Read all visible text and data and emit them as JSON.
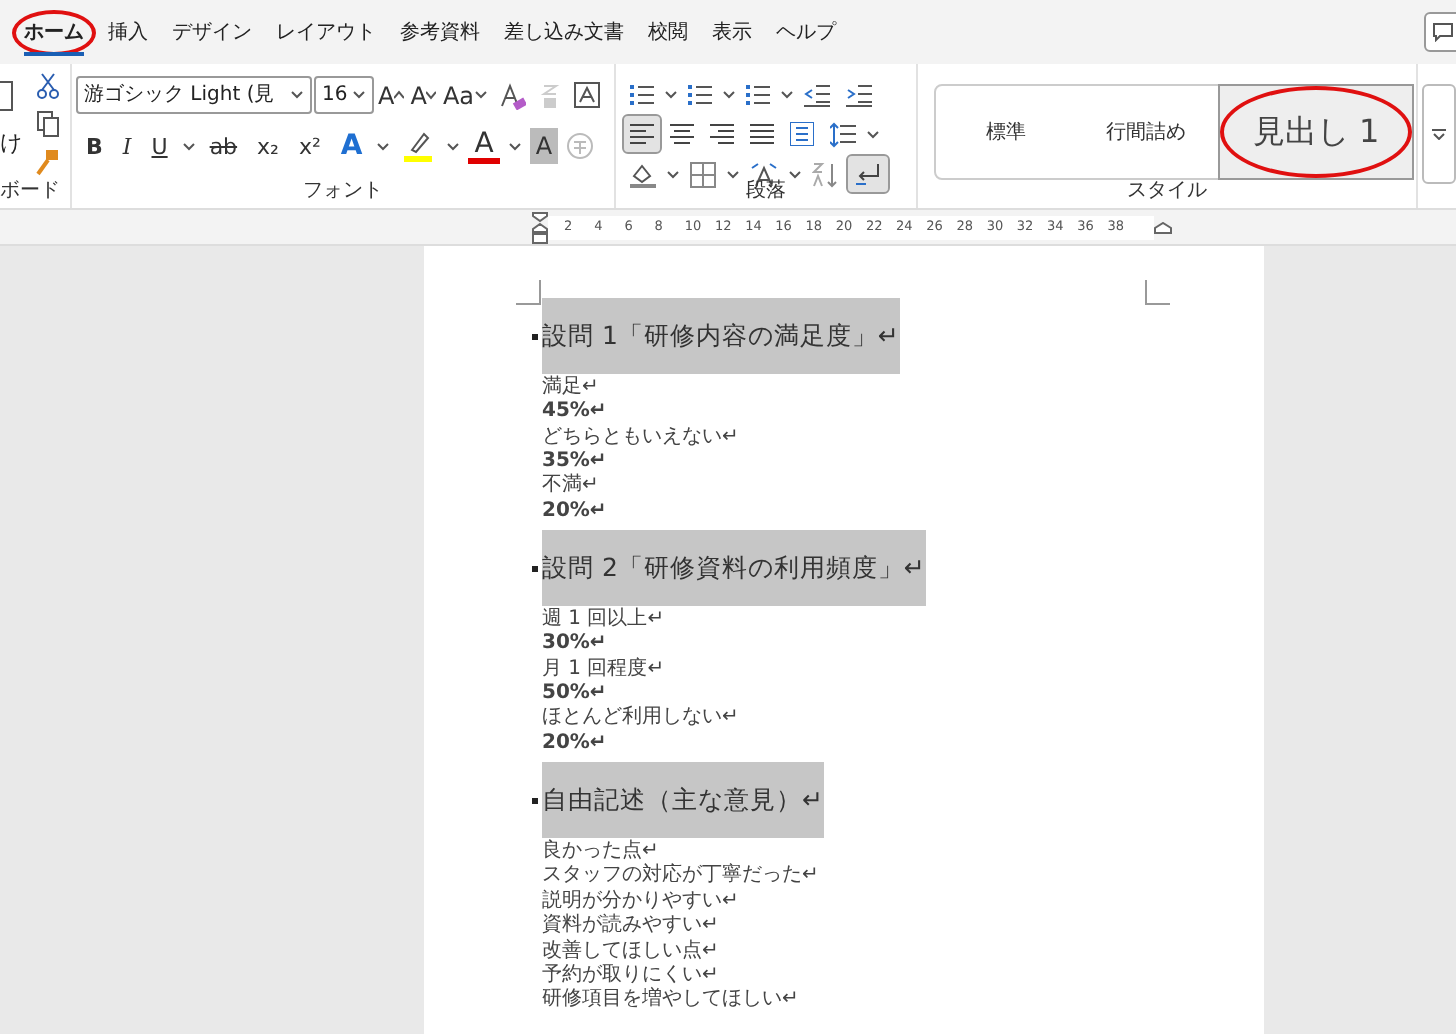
{
  "menu_tabs": [
    {
      "label": "ホーム",
      "selected": true,
      "circled": true
    },
    {
      "label": "挿入",
      "selected": false,
      "circled": false
    },
    {
      "label": "デザイン",
      "selected": false,
      "circled": false
    },
    {
      "label": "レイアウト",
      "selected": false,
      "circled": false
    },
    {
      "label": "参考資料",
      "selected": false,
      "circled": false
    },
    {
      "label": "差し込み文書",
      "selected": false,
      "circled": false
    },
    {
      "label": "校閲",
      "selected": false,
      "circled": false
    },
    {
      "label": "表示",
      "selected": false,
      "circled": false
    },
    {
      "label": "ヘルプ",
      "selected": false,
      "circled": false
    }
  ],
  "clipboard": {
    "paste_label": "け",
    "group_label": "ボード"
  },
  "font": {
    "name": "游ゴシック Light (見",
    "size": "16",
    "group_label": "フォント",
    "row1": [
      {
        "kind": "grow",
        "label": "A"
      },
      {
        "kind": "shrink",
        "label": "A"
      },
      {
        "kind": "case",
        "label": "Aa"
      }
    ],
    "row2": [
      "B",
      "I",
      "U",
      "ab",
      "x₂",
      "x²"
    ],
    "colors": [
      {
        "kind": "effect",
        "label": "A",
        "color": "#1f6fd1"
      },
      {
        "kind": "highlight",
        "color": "#ffff00"
      },
      {
        "kind": "fontcolor",
        "label": "A",
        "color": "#e00000"
      },
      {
        "kind": "shade",
        "label": "A"
      }
    ]
  },
  "paragraph": {
    "group_label": "段落",
    "align": [
      {
        "selected": true
      },
      {
        "selected": false
      },
      {
        "selected": false
      },
      {
        "selected": false
      },
      {
        "selected": false
      }
    ],
    "show_marks": true
  },
  "styles": {
    "group_label": "スタイル",
    "items": [
      {
        "label": "標準",
        "selected": false,
        "circled": false
      },
      {
        "label": "行間詰め",
        "selected": false,
        "circled": false
      },
      {
        "label": "見出し 1",
        "selected": true,
        "circled": true
      }
    ]
  },
  "ruler": [
    "2",
    "4",
    "6",
    "8",
    "10",
    "12",
    "14",
    "16",
    "18",
    "20",
    "22",
    "24",
    "26",
    "28",
    "30",
    "32",
    "34",
    "36",
    "38"
  ],
  "document": [
    {
      "heading": "設問 1「研修内容の満足度」↵",
      "lines": [
        {
          "text": "満足↵",
          "bold": false
        },
        {
          "text": "45%↵",
          "bold": true
        },
        {
          "text": "どちらともいえない↵",
          "bold": false
        },
        {
          "text": "35%↵",
          "bold": true
        },
        {
          "text": "不満↵",
          "bold": false
        },
        {
          "text": "20%↵",
          "bold": true
        }
      ]
    },
    {
      "heading": "設問 2「研修資料の利用頻度」↵",
      "lines": [
        {
          "text": "週 1 回以上↵",
          "bold": false
        },
        {
          "text": "30%↵",
          "bold": true
        },
        {
          "text": "月 1 回程度↵",
          "bold": false
        },
        {
          "text": "50%↵",
          "bold": true
        },
        {
          "text": "ほとんど利用しない↵",
          "bold": false
        },
        {
          "text": "20%↵",
          "bold": true
        }
      ]
    },
    {
      "heading": "自由記述（主な意見）↵",
      "lines": [
        {
          "text": "良かった点↵",
          "bold": false
        },
        {
          "text": "スタッフの対応が丁寧だった↵",
          "bold": false
        },
        {
          "text": "説明が分かりやすい↵",
          "bold": false
        },
        {
          "text": "資料が読みやすい↵",
          "bold": false
        },
        {
          "text": "改善してほしい点↵",
          "bold": false
        },
        {
          "text": "予約が取りにくい↵",
          "bold": false
        },
        {
          "text": "研修項目を増やしてほしい↵",
          "bold": false
        }
      ]
    }
  ]
}
